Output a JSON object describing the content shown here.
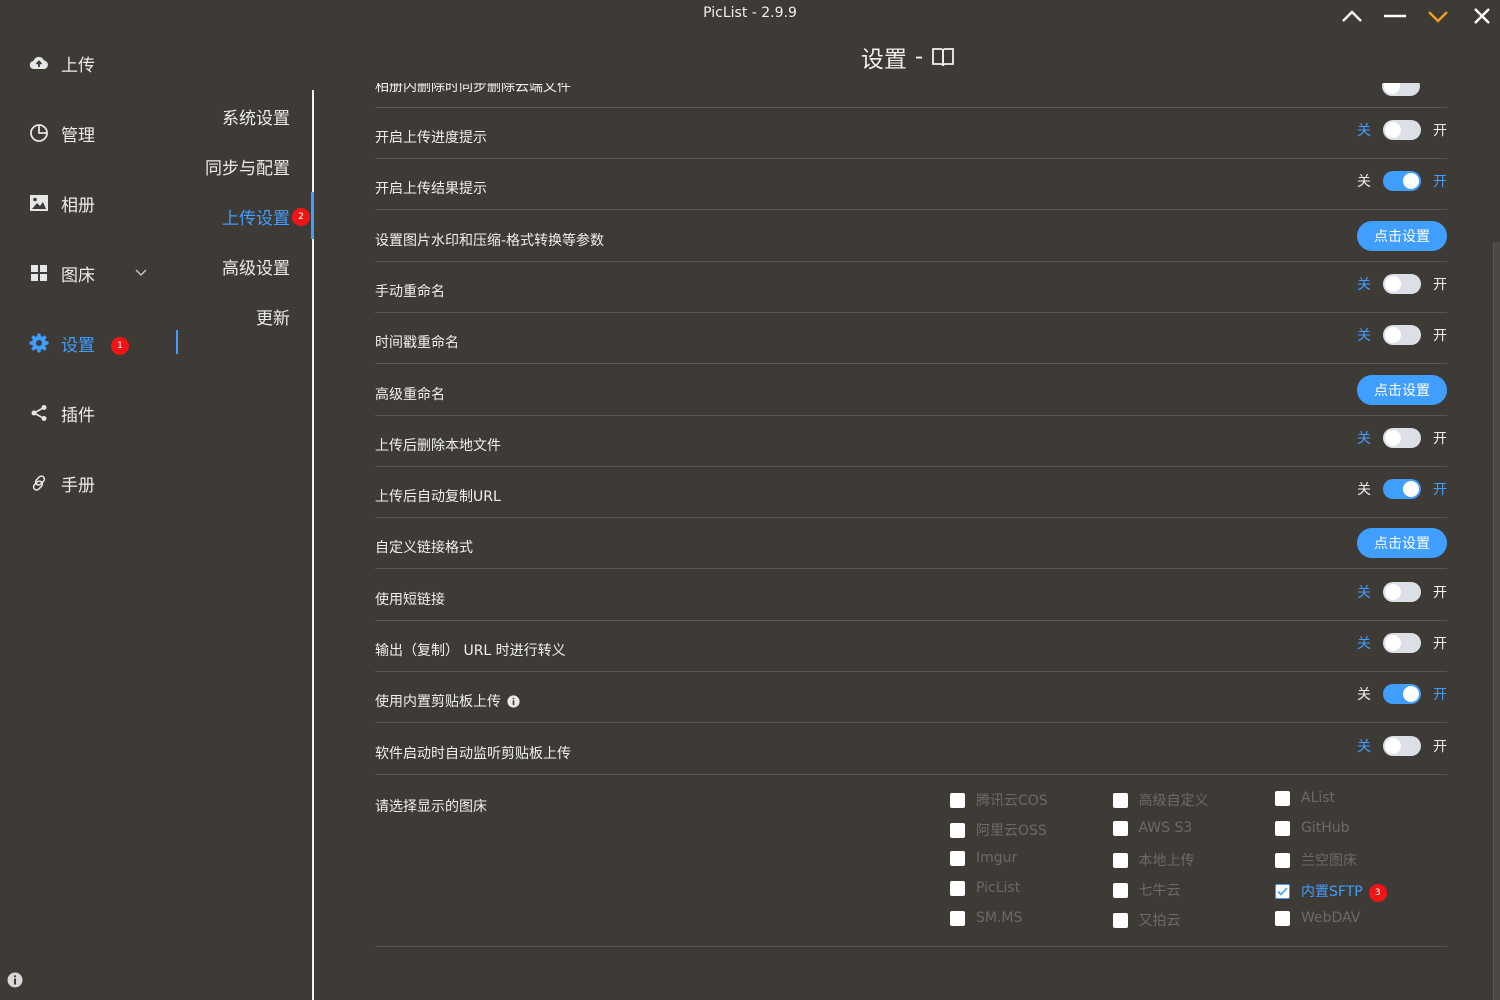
{
  "window": {
    "title": "PicList - 2.9.9"
  },
  "sidebar": {
    "items": [
      {
        "label": "上传",
        "icon": "cloud-upload-icon"
      },
      {
        "label": "管理",
        "icon": "pie-chart-icon"
      },
      {
        "label": "相册",
        "icon": "picture-icon"
      },
      {
        "label": "图床",
        "icon": "grid-icon"
      },
      {
        "label": "设置",
        "icon": "gear-icon",
        "badge": "1"
      },
      {
        "label": "插件",
        "icon": "share-icon"
      },
      {
        "label": "手册",
        "icon": "link-icon"
      }
    ]
  },
  "subnav": {
    "items": [
      {
        "label": "系统设置"
      },
      {
        "label": "同步与配置"
      },
      {
        "label": "上传设置",
        "badge": "2"
      },
      {
        "label": "高级设置"
      },
      {
        "label": "更新"
      }
    ]
  },
  "header": {
    "title": "设置",
    "sep": "-"
  },
  "switch_labels": {
    "off": "关",
    "on": "开"
  },
  "settings": {
    "partial_label": "相册内删除时同步删除云端文件",
    "rows": [
      {
        "label": "开启上传进度提示",
        "type": "switch",
        "value": false
      },
      {
        "label": "开启上传结果提示",
        "type": "switch",
        "value": true
      },
      {
        "label": "设置图片水印和压缩-格式转换等参数",
        "type": "button",
        "button": "点击设置"
      },
      {
        "label": "手动重命名",
        "type": "switch",
        "value": false
      },
      {
        "label": "时间戳重命名",
        "type": "switch",
        "value": false
      },
      {
        "label": "高级重命名",
        "type": "button",
        "button": "点击设置"
      },
      {
        "label": "上传后删除本地文件",
        "type": "switch",
        "value": false
      },
      {
        "label": "上传后自动复制URL",
        "type": "switch",
        "value": true
      },
      {
        "label": "自定义链接格式",
        "type": "button",
        "button": "点击设置"
      },
      {
        "label": "使用短链接",
        "type": "switch",
        "value": false
      },
      {
        "label": "输出（复制） URL 时进行转义",
        "type": "switch",
        "value": false
      },
      {
        "label": "使用内置剪贴板上传",
        "type": "switch",
        "value": true,
        "info": true
      },
      {
        "label": "软件启动时自动监听剪贴板上传",
        "type": "switch",
        "value": false
      }
    ],
    "picbed_select": {
      "label": "请选择显示的图床",
      "options": [
        {
          "label": "腾讯云COS",
          "checked": false
        },
        {
          "label": "高级自定义",
          "checked": false
        },
        {
          "label": "AList",
          "checked": false
        },
        {
          "label": "阿里云OSS",
          "checked": false
        },
        {
          "label": "AWS S3",
          "checked": false
        },
        {
          "label": "GitHub",
          "checked": false
        },
        {
          "label": "Imgur",
          "checked": false
        },
        {
          "label": "本地上传",
          "checked": false
        },
        {
          "label": "兰空图床",
          "checked": false
        },
        {
          "label": "PicList",
          "checked": false
        },
        {
          "label": "七牛云",
          "checked": false
        },
        {
          "label": "内置SFTP",
          "checked": true,
          "badge": "3"
        },
        {
          "label": "SM.MS",
          "checked": false
        },
        {
          "label": "又拍云",
          "checked": false
        },
        {
          "label": "WebDAV",
          "checked": false
        }
      ]
    }
  },
  "colors": {
    "accent": "#409eff",
    "background": "#3e3b37",
    "badge": "#f01414",
    "minimize_highlight": "#f0a020"
  }
}
